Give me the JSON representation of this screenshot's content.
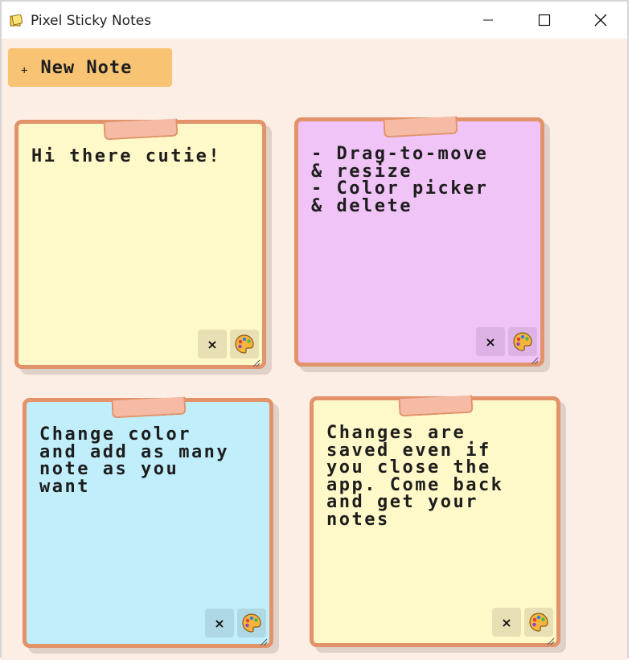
{
  "window": {
    "title": "Pixel Sticky Notes",
    "app_icon": "sticky-note-icon",
    "controls": [
      "minimize-icon",
      "maximize-icon",
      "close-icon"
    ]
  },
  "toolbar": {
    "new_note_icon": "+",
    "new_note_label": "New Note"
  },
  "notes": [
    {
      "text": "Hi there cutie!",
      "color": "#fff8c8",
      "button_color": "#e8e0b4",
      "delete_label": "×",
      "palette_icon": "palette-icon"
    },
    {
      "text": "- Drag-to-move\n& resize\n- Color picker\n& delete",
      "color": "#f0c4f6",
      "button_color": "#ddb2e4",
      "delete_label": "×",
      "palette_icon": "palette-icon"
    },
    {
      "text": "Change color\nand add as many\nnote as you\nwant",
      "color": "#c1eefb",
      "button_color": "#aed8e4",
      "delete_label": "×",
      "palette_icon": "palette-icon"
    },
    {
      "text": "Changes are\nsaved even if\nyou close the\napp. Come back\nand get your\nnotes",
      "color": "#fff8c8",
      "button_color": "#e8e0b4",
      "delete_label": "×",
      "palette_icon": "palette-icon"
    }
  ],
  "colors": {
    "background": "#fdeee5",
    "border": "#e2936a",
    "tape": "#f5bba4",
    "button": "#f8c474"
  }
}
